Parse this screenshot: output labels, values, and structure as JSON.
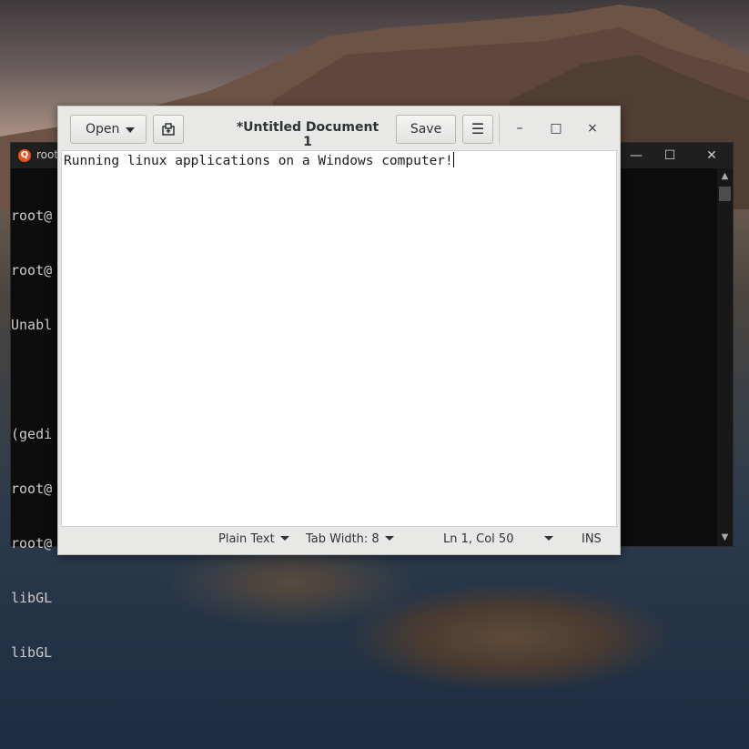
{
  "terminal": {
    "title": "root",
    "icon": "ubuntu-icon",
    "lines": [
      "root@",
      "root@",
      "Unabl",
      "",
      "(gedi",
      "root@",
      "root@",
      "libGL",
      "libGL"
    ],
    "controls": {
      "minimize": "—",
      "maximize": "☐",
      "close": "✕"
    }
  },
  "gedit": {
    "open_label": "Open",
    "new_doc_icon": "new-document-icon",
    "title": "*Untitled Document 1",
    "save_label": "Save",
    "menu_icon": "☰",
    "window_controls": {
      "minimize": "–",
      "maximize": "□",
      "close": "×"
    },
    "content": "Running linux applications on a Windows computer!",
    "status": {
      "language": "Plain Text",
      "tab_width": "Tab Width: 8",
      "position": "Ln 1, Col 50",
      "mode": "INS"
    }
  },
  "colors": {
    "terminal_bg": "#0c0c0c",
    "ubuntu_orange": "#e95420",
    "gedit_chrome": "#e8e8e7"
  }
}
